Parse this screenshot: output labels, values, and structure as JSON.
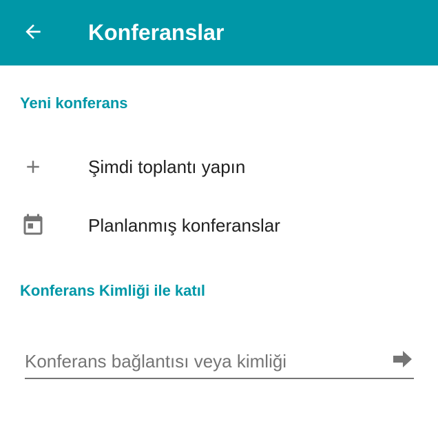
{
  "colors": {
    "primary": "#0097a7",
    "text": "#212121",
    "icon": "#757575",
    "surface": "#ffffff"
  },
  "toolbar": {
    "back_icon": "arrow-back-icon",
    "title": "Konferanslar"
  },
  "new_conference": {
    "header": "Yeni konferans",
    "items": [
      {
        "icon": "plus-icon",
        "label": "Şimdi toplantı yapın"
      },
      {
        "icon": "calendar-icon",
        "label": "Planlanmış konferanslar"
      }
    ]
  },
  "join": {
    "header": "Konferans Kimliği ile katıl",
    "input_placeholder": "Konferans bağlantısı veya kimliği",
    "input_value": "",
    "go_icon": "arrow-forward-icon"
  }
}
